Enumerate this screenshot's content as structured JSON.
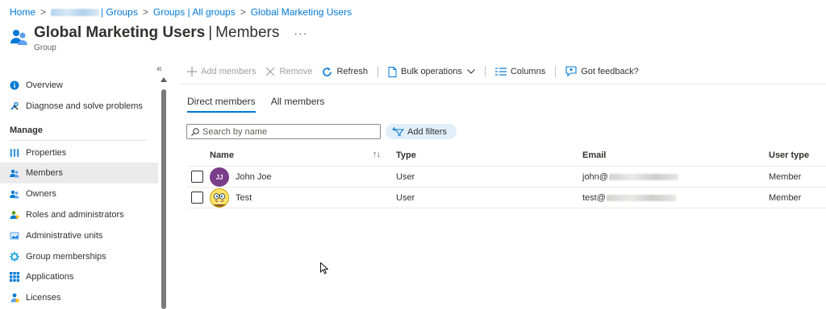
{
  "breadcrumb": {
    "home": "Home",
    "groups_suffix": "| Groups",
    "all_groups": "Groups | All groups",
    "current": "Global Marketing Users"
  },
  "header": {
    "title": "Global Marketing Users",
    "separator": "|",
    "section": "Members",
    "more": "···",
    "subtitle": "Group"
  },
  "sidebar": {
    "collapse_glyph": "«",
    "manage_heading": "Manage",
    "items": [
      {
        "label": "Overview",
        "icon": "info-icon"
      },
      {
        "label": "Diagnose and solve problems",
        "icon": "wrench-icon"
      },
      {
        "label": "Properties",
        "icon": "properties-icon"
      },
      {
        "label": "Members",
        "icon": "members-icon",
        "active": true
      },
      {
        "label": "Owners",
        "icon": "owners-icon"
      },
      {
        "label": "Roles and administrators",
        "icon": "roles-icon"
      },
      {
        "label": "Administrative units",
        "icon": "admin-units-icon"
      },
      {
        "label": "Group memberships",
        "icon": "gear-icon"
      },
      {
        "label": "Applications",
        "icon": "apps-grid-icon"
      },
      {
        "label": "Licenses",
        "icon": "license-icon"
      }
    ]
  },
  "toolbar": {
    "add_members": "Add members",
    "remove": "Remove",
    "refresh": "Refresh",
    "bulk_operations": "Bulk operations",
    "columns": "Columns",
    "feedback": "Got feedback?"
  },
  "tabs": {
    "direct": "Direct members",
    "all": "All members"
  },
  "search": {
    "placeholder": "Search by name"
  },
  "filters": {
    "add_label": "Add filters"
  },
  "table": {
    "columns": [
      "Name",
      "Type",
      "Email",
      "User type"
    ],
    "sort_glyph": "↑↓",
    "rows": [
      {
        "initials": "JJ",
        "name": "John Joe",
        "type": "User",
        "email_prefix": "john@",
        "user_type": "Member"
      },
      {
        "initials": "",
        "name": "Test",
        "type": "User",
        "email_prefix": "test@",
        "user_type": "Member"
      }
    ]
  },
  "colors": {
    "accent": "#0078d4",
    "avatar_jj": "#7b3e8a",
    "filter_pill": "#e1effa"
  }
}
